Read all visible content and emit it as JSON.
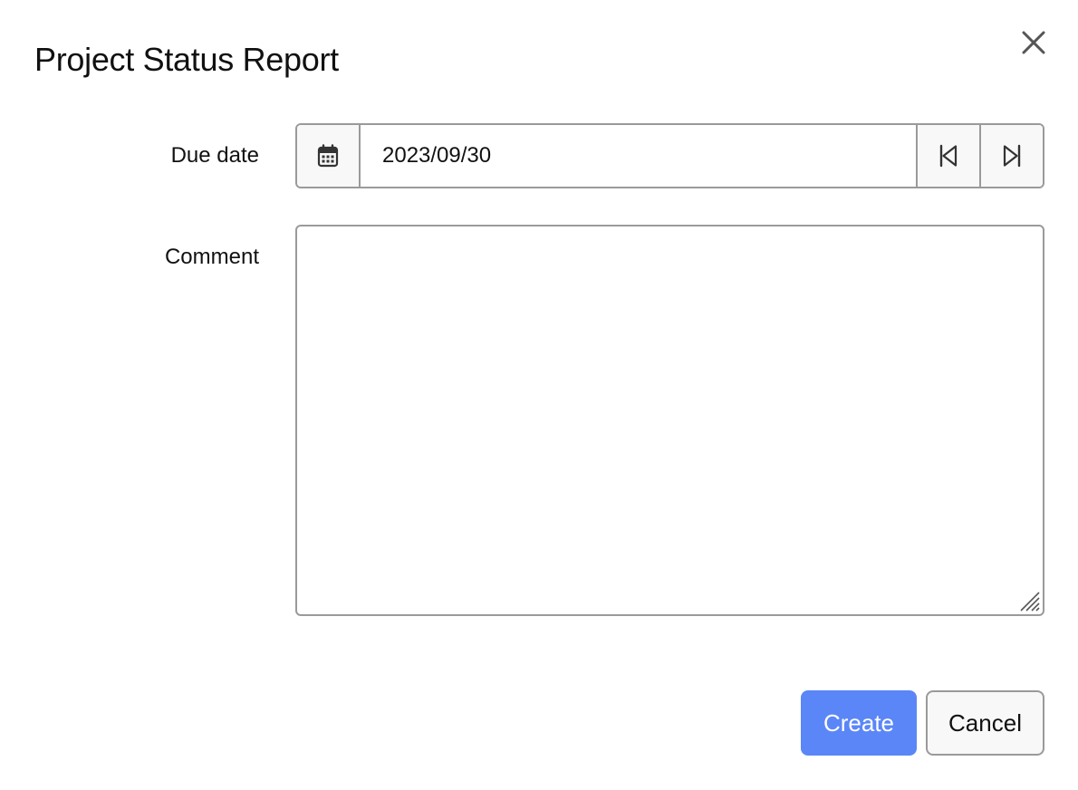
{
  "dialog": {
    "title": "Project Status Report",
    "close_icon": "close-icon"
  },
  "form": {
    "due_date": {
      "label": "Due date",
      "value": "2023/09/30",
      "calendar_icon": "calendar-icon",
      "prev_icon": "skip-previous-icon",
      "next_icon": "skip-next-icon"
    },
    "comment": {
      "label": "Comment",
      "value": ""
    }
  },
  "actions": {
    "create_label": "Create",
    "cancel_label": "Cancel"
  },
  "colors": {
    "primary": "#5b86f7",
    "border": "#9a9a9a",
    "button_bg": "#f8f8f8"
  }
}
